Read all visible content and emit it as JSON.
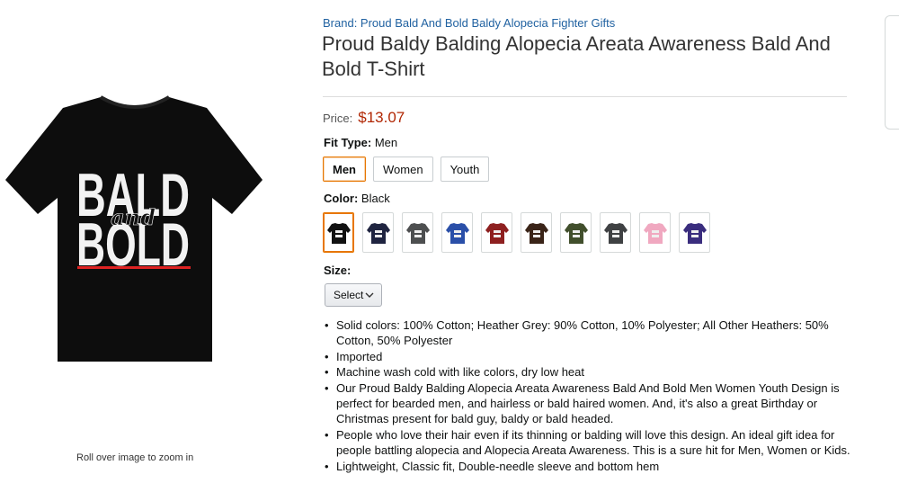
{
  "brand": {
    "label": "Brand: Proud Bald And Bold Baldy Alopecia Fighter Gifts"
  },
  "product": {
    "title": "Proud Baldy Balding Alopecia Areata Awareness Bald And Bold T-Shirt",
    "image_text_top": "BALD",
    "image_text_mid": "and",
    "image_text_bottom": "BOLD"
  },
  "image_panel": {
    "zoom_hint": "Roll over image to zoom in"
  },
  "price": {
    "label": "Price:",
    "value": "$13.07"
  },
  "fit_type": {
    "label": "Fit Type:",
    "value": "Men",
    "options": [
      "Men",
      "Women",
      "Youth"
    ],
    "selected_index": 0
  },
  "color": {
    "label": "Color:",
    "value": "Black",
    "swatches": [
      {
        "shirt": "#111111",
        "selected": true
      },
      {
        "shirt": "#1f2440"
      },
      {
        "shirt": "#4d4f50"
      },
      {
        "shirt": "#2a4fa8"
      },
      {
        "shirt": "#8e2020"
      },
      {
        "shirt": "#3a2418"
      },
      {
        "shirt": "#414f2c"
      },
      {
        "shirt": "#3f4143"
      },
      {
        "shirt": "#f0a8c0"
      },
      {
        "shirt": "#3a2d7e"
      }
    ]
  },
  "size": {
    "label": "Size:",
    "select_value": "Select"
  },
  "bullets": [
    "Solid colors: 100% Cotton; Heather Grey: 90% Cotton, 10% Polyester; All Other Heathers: 50% Cotton, 50% Polyester",
    "Imported",
    "Machine wash cold with like colors, dry low heat",
    "Our Proud Baldy Balding Alopecia Areata Awareness Bald And Bold Men Women Youth Design is perfect for bearded men, and hairless or bald haired women. And, it's also a great Birthday or Christmas present for bald guy, baldy or bald headed.",
    "People who love their hair even if its thinning or balding will love this design. An ideal gift idea for people battling alopecia and Alopecia Areata Awareness. This is a sure hit for Men, Women or Kids.",
    "Lightweight, Classic fit, Double-needle sleeve and bottom hem"
  ]
}
